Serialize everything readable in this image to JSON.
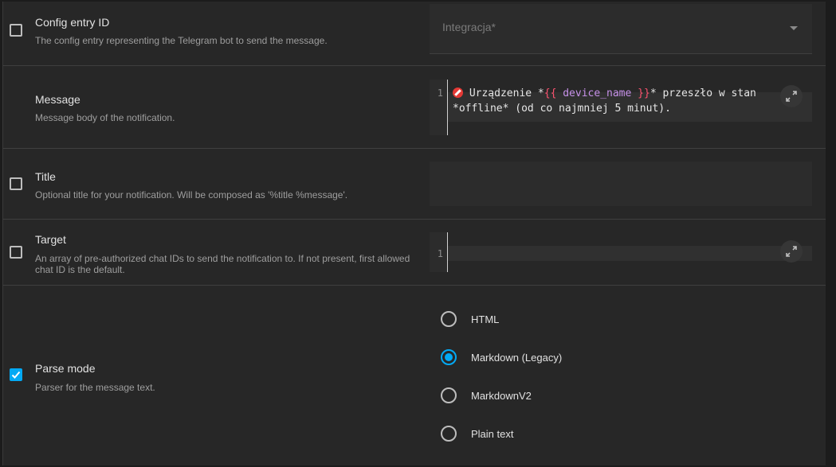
{
  "config_entry": {
    "label": "Config entry ID",
    "description": "The config entry representing the Telegram bot to send the message.",
    "select_label": "Integracja*"
  },
  "message": {
    "label": "Message",
    "description": "Message body of the notification.",
    "line_number": "1",
    "text_before": " Urządzenie *",
    "tpl_open": "{{",
    "var_name": " device_name ",
    "tpl_close": "}}",
    "text_after": "* przeszło w stan",
    "line_2": "*offline* (od co najmniej 5 minut)."
  },
  "title": {
    "label": "Title",
    "description": "Optional title for your notification. Will be composed as '%title %message'."
  },
  "target": {
    "label": "Target",
    "description": "An array of pre-authorized chat IDs to send the notification to. If not present, first allowed chat ID is the default.",
    "line_number": "1"
  },
  "parse_mode": {
    "label": "Parse mode",
    "description": "Parser for the message text.",
    "options": [
      "HTML",
      "Markdown (Legacy)",
      "MarkdownV2",
      "Plain text"
    ],
    "selected": "Markdown (Legacy)"
  },
  "colors": {
    "accent": "#03a9f4",
    "template_bracket": "#ff5370",
    "template_var": "#c792ea"
  },
  "icons": {
    "expand": "expand-icon",
    "check": "check-icon",
    "no_entry": "no-entry-emoji",
    "dropdown": "chevron-down-icon"
  }
}
